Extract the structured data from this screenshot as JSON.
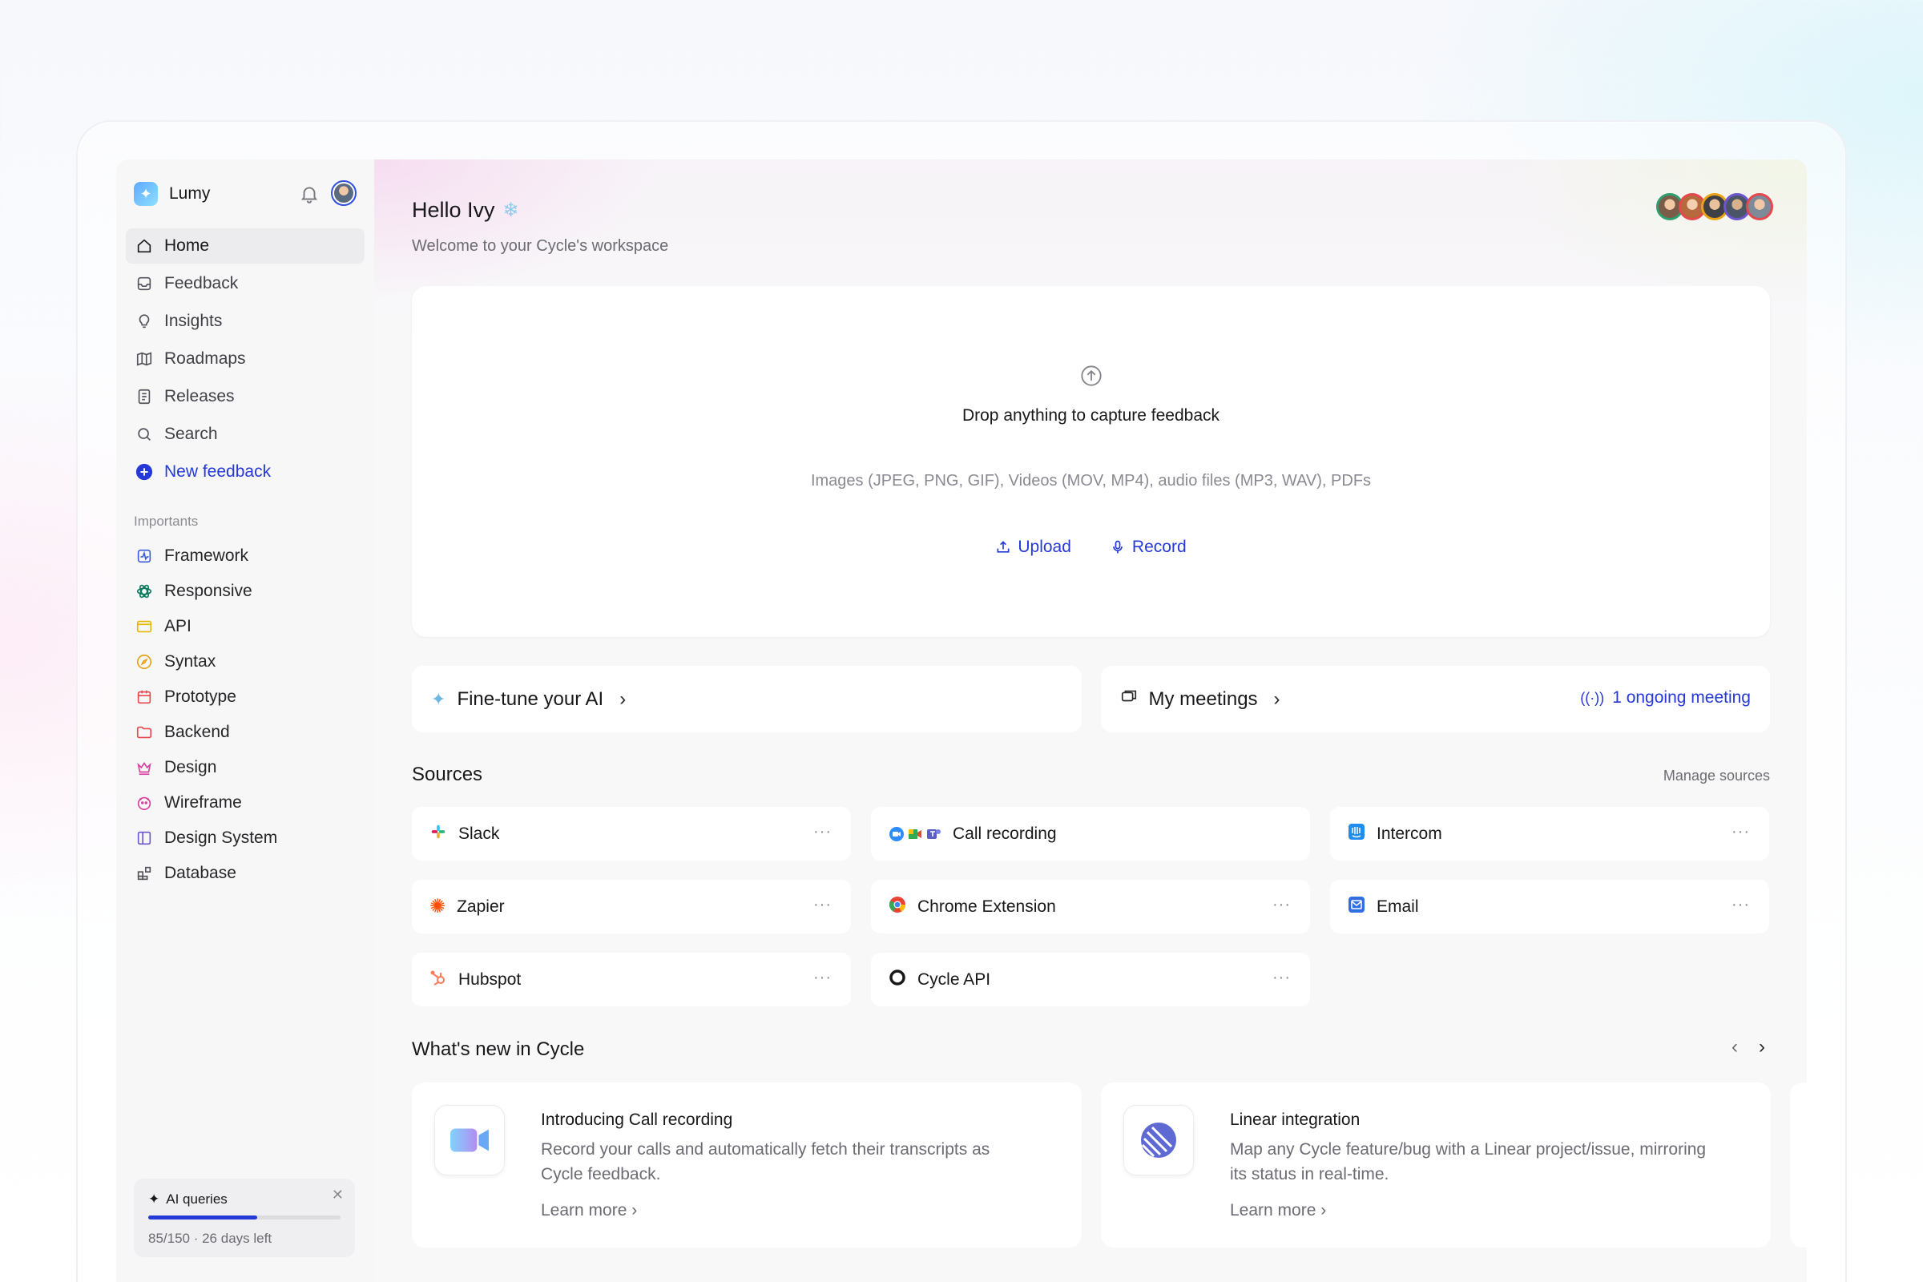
{
  "app": {
    "name": "Lumy"
  },
  "nav": [
    {
      "label": "Home",
      "icon": "home-icon"
    },
    {
      "label": "Feedback",
      "icon": "inbox-icon"
    },
    {
      "label": "Insights",
      "icon": "lightbulb-icon"
    },
    {
      "label": "Roadmaps",
      "icon": "map-icon"
    },
    {
      "label": "Releases",
      "icon": "document-icon"
    },
    {
      "label": "Search",
      "icon": "search-icon"
    },
    {
      "label": "New feedback",
      "icon": "plus-circle-icon"
    }
  ],
  "importants": {
    "label": "Importants",
    "items": [
      {
        "label": "Framework",
        "color": "#3b5bdb"
      },
      {
        "label": "Responsive",
        "color": "#0f7b5f"
      },
      {
        "label": "API",
        "color": "#e6b800"
      },
      {
        "label": "Syntax",
        "color": "#e8a317"
      },
      {
        "label": "Prototype",
        "color": "#e5484d"
      },
      {
        "label": "Backend",
        "color": "#e5484d"
      },
      {
        "label": "Design",
        "color": "#d6409f"
      },
      {
        "label": "Wireframe",
        "color": "#d6409f"
      },
      {
        "label": "Design System",
        "color": "#6e56cf"
      },
      {
        "label": "Database",
        "color": "#52525b"
      }
    ]
  },
  "quota": {
    "title": "AI queries",
    "used": 85,
    "total": 150,
    "summary": "85/150 · 26 days left"
  },
  "header": {
    "greeting": "Hello Ivy",
    "subtitle": "Welcome to your Cycle's workspace"
  },
  "dropzone": {
    "title": "Drop anything to capture feedback",
    "formats": "Images (JPEG, PNG, GIF), Videos (MOV, MP4), audio files (MP3, WAV), PDFs",
    "upload": "Upload",
    "record": "Record"
  },
  "quick": {
    "finetune": "Fine-tune your AI",
    "meetings": "My meetings",
    "ongoing": "1 ongoing meeting"
  },
  "sources": {
    "title": "Sources",
    "manage": "Manage sources",
    "items": [
      {
        "label": "Slack",
        "icon": "slack-icon"
      },
      {
        "label": "Call recording",
        "icon": "call-apps-icon"
      },
      {
        "label": "Intercom",
        "icon": "intercom-icon"
      },
      {
        "label": "Zapier",
        "icon": "zapier-icon"
      },
      {
        "label": "Chrome Extension",
        "icon": "chrome-icon"
      },
      {
        "label": "Email",
        "icon": "email-icon"
      },
      {
        "label": "Hubspot",
        "icon": "hubspot-icon"
      },
      {
        "label": "Cycle API",
        "icon": "cycle-api-icon"
      }
    ]
  },
  "whats_new": {
    "title": "What's new in Cycle",
    "cards": [
      {
        "title": "Introducing Call recording",
        "desc": "Record your calls and automatically fetch their transcripts as Cycle feedback.",
        "cta": "Learn more"
      },
      {
        "title": "Linear integration",
        "desc": "Map any Cycle feature/bug with a Linear project/issue, mirroring its status in real-time.",
        "cta": "Learn more"
      }
    ]
  },
  "colors": {
    "accent": "#2439d8"
  }
}
